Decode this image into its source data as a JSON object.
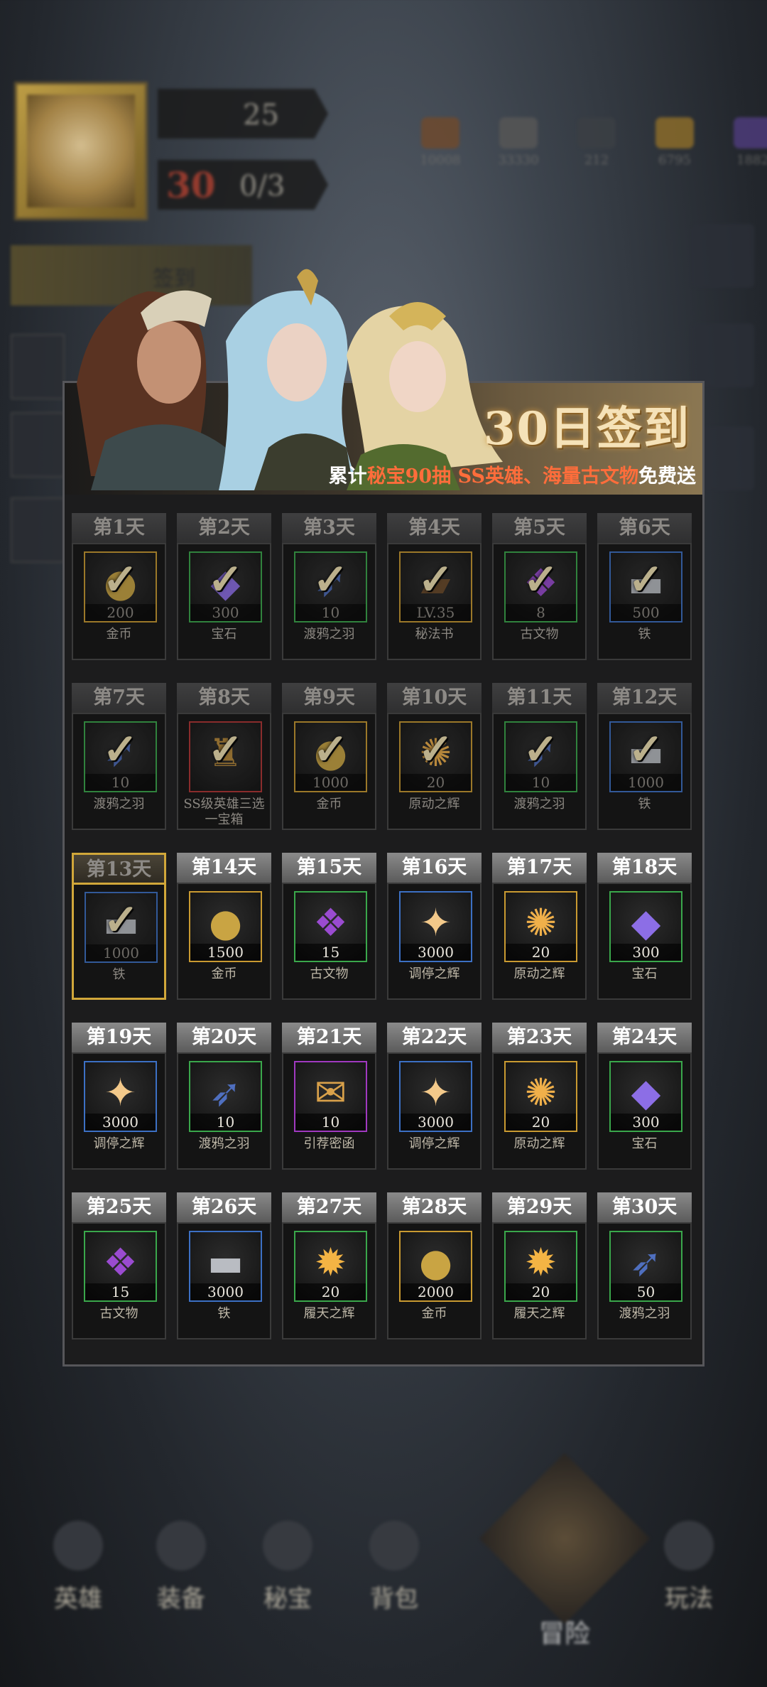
{
  "hud": {
    "level": "25",
    "stamina_big": "30",
    "stamina": "0/3",
    "resources": [
      {
        "name": "food-icon",
        "value": "10008",
        "color": "#6e4a2e"
      },
      {
        "name": "iron-icon",
        "value": "33330",
        "color": "#565656"
      },
      {
        "name": "feather-icon",
        "value": "212",
        "color": "#3b3f44"
      },
      {
        "name": "gold-coin-icon",
        "value": "6795",
        "color": "#8a6b2a"
      },
      {
        "name": "gem-icon",
        "value": "1882",
        "color": "#4d3b7a"
      }
    ],
    "left_banner": "签到"
  },
  "modal": {
    "title": "30日签到",
    "subtitle_pre": "累计",
    "subtitle_hl1": "秘宝90抽",
    "subtitle_hl2": "SS英雄、海量古文物",
    "subtitle_post": "免费送"
  },
  "days": [
    {
      "day": "第1天",
      "qty": "200",
      "name": "金币",
      "icon": "gold-coin",
      "frame": "gold",
      "done": true
    },
    {
      "day": "第2天",
      "qty": "300",
      "name": "宝石",
      "icon": "gem",
      "frame": "green",
      "done": true
    },
    {
      "day": "第3天",
      "qty": "10",
      "name": "渡鸦之羽",
      "icon": "raven-feather",
      "frame": "green",
      "done": true
    },
    {
      "day": "第4天",
      "qty": "LV.35",
      "name": "秘法书",
      "icon": "spellbook",
      "frame": "gold",
      "done": true
    },
    {
      "day": "第5天",
      "qty": "8",
      "name": "古文物",
      "icon": "artifact",
      "frame": "green",
      "done": true
    },
    {
      "day": "第6天",
      "qty": "500",
      "name": "铁",
      "icon": "iron-ingot",
      "frame": "blue",
      "done": true
    },
    {
      "day": "第7天",
      "qty": "10",
      "name": "渡鸦之羽",
      "icon": "raven-feather",
      "frame": "green",
      "done": true
    },
    {
      "day": "第8天",
      "qty": "",
      "name": "SS级英雄三选一宝箱",
      "icon": "treasure-chest",
      "frame": "red",
      "done": true
    },
    {
      "day": "第9天",
      "qty": "1000",
      "name": "金币",
      "icon": "gold-coin",
      "frame": "gold",
      "done": true
    },
    {
      "day": "第10天",
      "qty": "20",
      "name": "原动之辉",
      "icon": "prime-radiance",
      "frame": "gold",
      "done": true
    },
    {
      "day": "第11天",
      "qty": "10",
      "name": "渡鸦之羽",
      "icon": "raven-feather",
      "frame": "green",
      "done": true
    },
    {
      "day": "第12天",
      "qty": "1000",
      "name": "铁",
      "icon": "iron-ingot",
      "frame": "blue",
      "done": true
    },
    {
      "day": "第13天",
      "qty": "1000",
      "name": "铁",
      "icon": "iron-ingot",
      "frame": "blue",
      "done": true,
      "today": true
    },
    {
      "day": "第14天",
      "qty": "1500",
      "name": "金币",
      "icon": "gold-coin",
      "frame": "gold",
      "done": false
    },
    {
      "day": "第15天",
      "qty": "15",
      "name": "古文物",
      "icon": "artifact",
      "frame": "green",
      "done": false
    },
    {
      "day": "第16天",
      "qty": "3000",
      "name": "调停之辉",
      "icon": "mediation-radiance",
      "frame": "blue",
      "done": false
    },
    {
      "day": "第17天",
      "qty": "20",
      "name": "原动之辉",
      "icon": "prime-radiance",
      "frame": "gold",
      "done": false
    },
    {
      "day": "第18天",
      "qty": "300",
      "name": "宝石",
      "icon": "gem",
      "frame": "green",
      "done": false
    },
    {
      "day": "第19天",
      "qty": "3000",
      "name": "调停之辉",
      "icon": "mediation-radiance",
      "frame": "blue",
      "done": false
    },
    {
      "day": "第20天",
      "qty": "10",
      "name": "渡鸦之羽",
      "icon": "raven-feather",
      "frame": "green",
      "done": false
    },
    {
      "day": "第21天",
      "qty": "10",
      "name": "引荐密函",
      "icon": "recommendation-letter",
      "frame": "purple",
      "done": false
    },
    {
      "day": "第22天",
      "qty": "3000",
      "name": "调停之辉",
      "icon": "mediation-radiance",
      "frame": "blue",
      "done": false
    },
    {
      "day": "第23天",
      "qty": "20",
      "name": "原动之辉",
      "icon": "prime-radiance",
      "frame": "gold",
      "done": false
    },
    {
      "day": "第24天",
      "qty": "300",
      "name": "宝石",
      "icon": "gem",
      "frame": "green",
      "done": false
    },
    {
      "day": "第25天",
      "qty": "15",
      "name": "古文物",
      "icon": "artifact",
      "frame": "green",
      "done": false
    },
    {
      "day": "第26天",
      "qty": "3000",
      "name": "铁",
      "icon": "iron-ingot",
      "frame": "blue",
      "done": false
    },
    {
      "day": "第27天",
      "qty": "20",
      "name": "履天之辉",
      "icon": "heaven-radiance",
      "frame": "green",
      "done": false
    },
    {
      "day": "第28天",
      "qty": "2000",
      "name": "金币",
      "icon": "gold-coin",
      "frame": "gold",
      "done": false
    },
    {
      "day": "第29天",
      "qty": "20",
      "name": "履天之辉",
      "icon": "heaven-radiance",
      "frame": "green",
      "done": false
    },
    {
      "day": "第30天",
      "qty": "50",
      "name": "渡鸦之羽",
      "icon": "raven-feather",
      "frame": "green",
      "done": false
    }
  ],
  "nav": {
    "heroes": "英雄",
    "equipment": "装备",
    "treasure": "秘宝",
    "backpack": "背包",
    "adventure": "冒险",
    "gameplay": "玩法"
  }
}
